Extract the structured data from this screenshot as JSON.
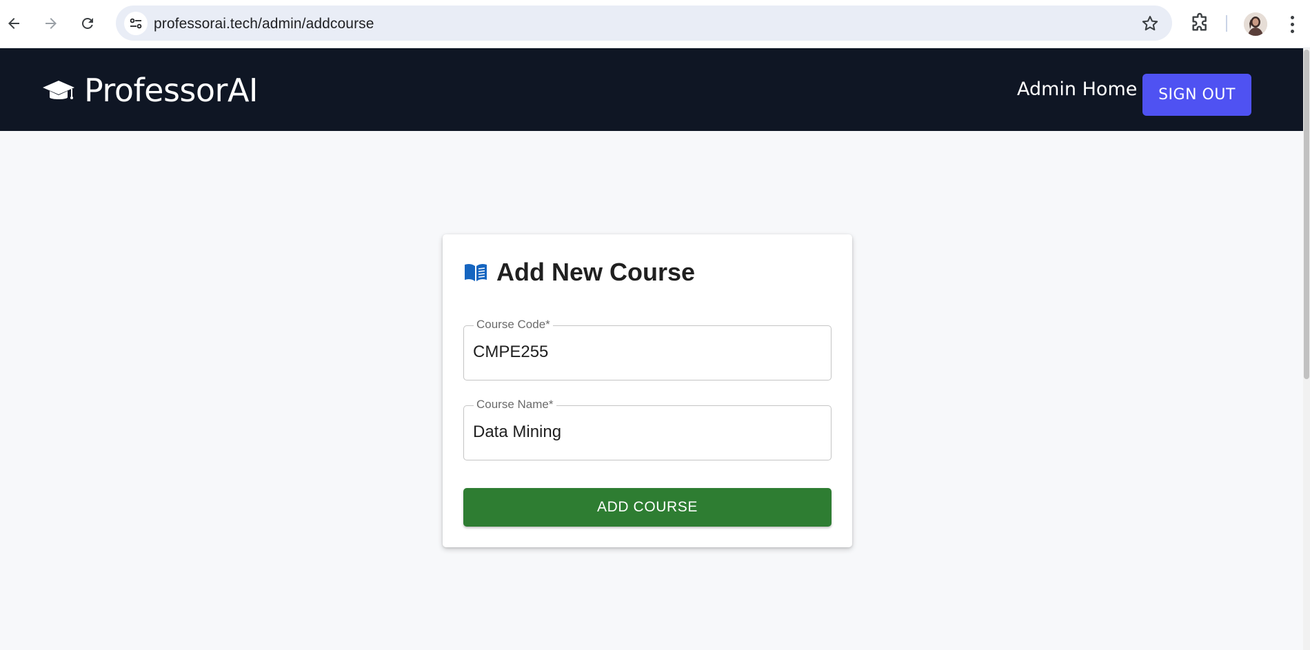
{
  "browser": {
    "url": "professorai.tech/admin/addcourse",
    "icons": [
      "back-icon",
      "forward-icon",
      "reload-icon",
      "site-info-icon",
      "bookmark-star-icon",
      "extensions-icon",
      "profile-avatar",
      "kebab-menu-icon"
    ]
  },
  "header": {
    "brand_name": "ProfessorAI",
    "brand_icon": "graduation-cap-icon",
    "nav_admin_home": "Admin Home",
    "signout_label": "SIGN OUT",
    "colors": {
      "header_bg": "#0f1624",
      "signout_bg": "#4f52f2"
    }
  },
  "card": {
    "title": "Add New Course",
    "title_icon": "book-icon",
    "fields": [
      {
        "label": "Course Code",
        "required_mark": "*",
        "value": "CMPE255"
      },
      {
        "label": "Course Name",
        "required_mark": "*",
        "value": "Data Mining"
      }
    ],
    "submit_label": "ADD COURSE",
    "colors": {
      "submit_bg": "#2e7d32",
      "icon_color": "#1565c0"
    }
  }
}
